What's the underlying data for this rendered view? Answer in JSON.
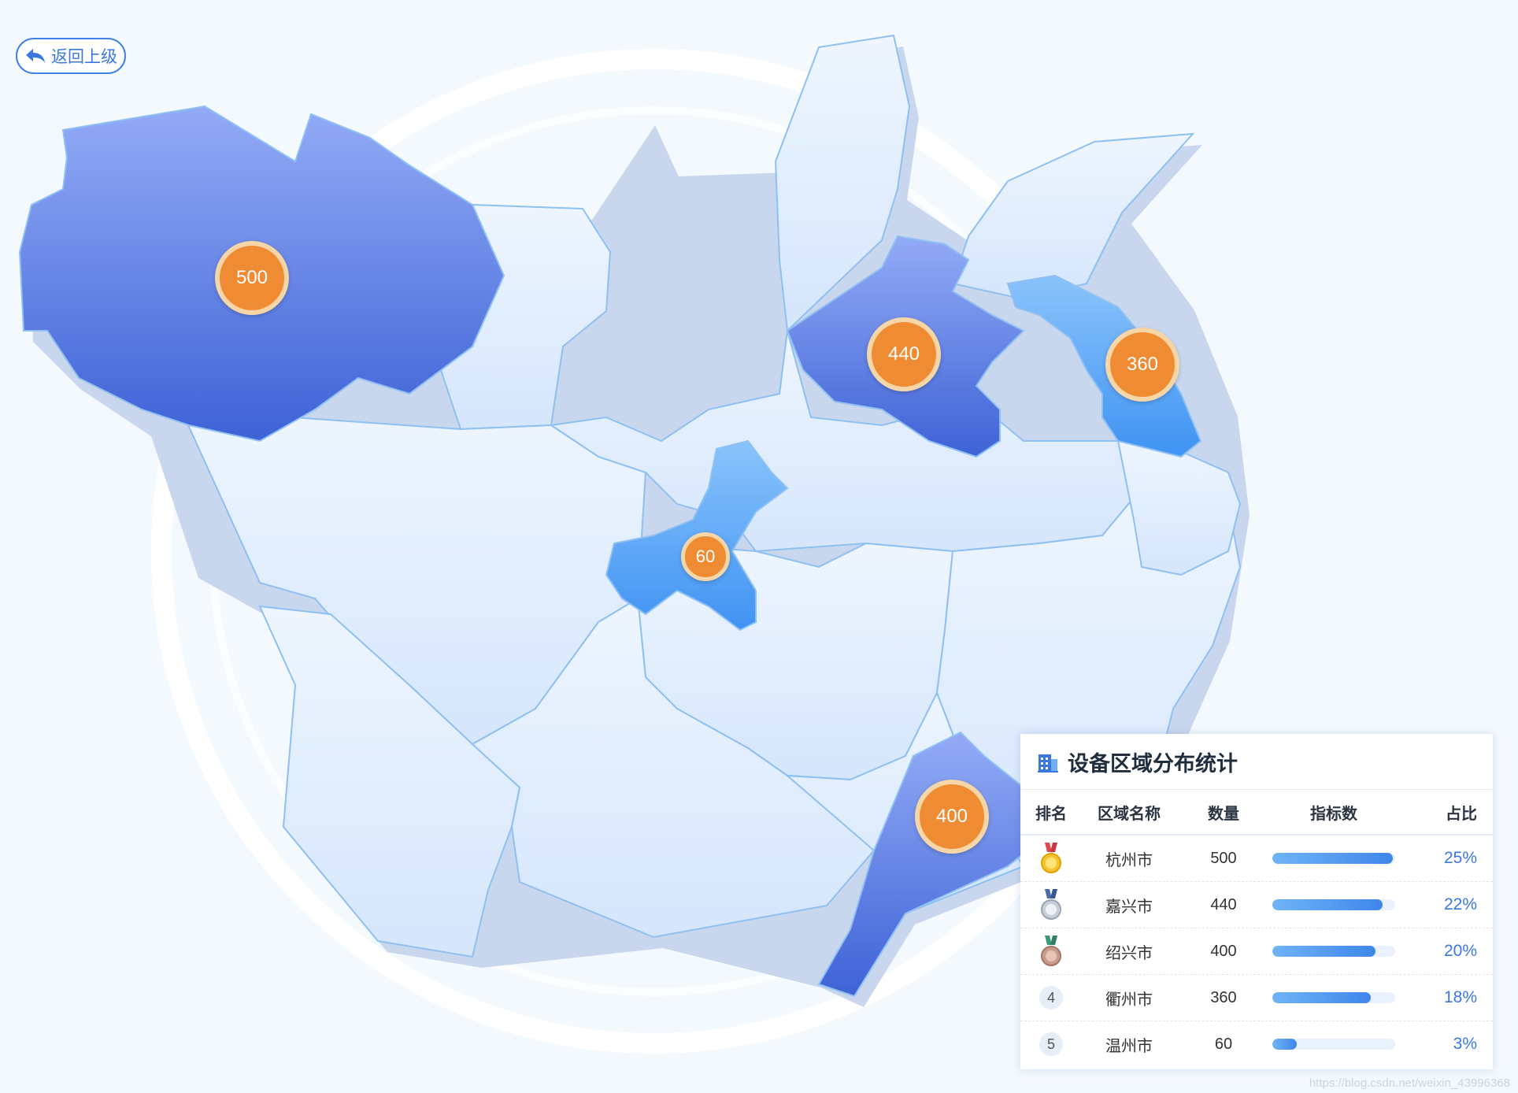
{
  "nav": {
    "back_label": "返回上级"
  },
  "regions": [
    {
      "name": "杭州市",
      "count": 500,
      "highlight": "dark"
    },
    {
      "name": "嘉兴市",
      "count": 440,
      "highlight": "dark"
    },
    {
      "name": "衢州市",
      "count": 360,
      "highlight": "medium"
    },
    {
      "name": "温州市",
      "count": 60,
      "highlight": "medium"
    },
    {
      "name": "绍兴市",
      "count": 400,
      "highlight": "dark"
    }
  ],
  "markers": [
    "500",
    "440",
    "360",
    "60",
    "400"
  ],
  "panel": {
    "title": "设备区域分布统计",
    "title_icon": "building-icon",
    "headers": {
      "rank": "排名",
      "name": "区域名称",
      "count": "数量",
      "index": "指标数",
      "ratio": "占比"
    },
    "rows": [
      {
        "rank": "1",
        "medal": "gold",
        "name": "杭州市",
        "count": "500",
        "fill": 0.98,
        "ratio": "25%"
      },
      {
        "rank": "2",
        "medal": "silver",
        "name": "嘉兴市",
        "count": "440",
        "fill": 0.9,
        "ratio": "22%"
      },
      {
        "rank": "3",
        "medal": "bronze",
        "name": "绍兴市",
        "count": "400",
        "fill": 0.84,
        "ratio": "20%"
      },
      {
        "rank": "4",
        "medal": "",
        "name": "衢州市",
        "count": "360",
        "fill": 0.8,
        "ratio": "18%"
      },
      {
        "rank": "5",
        "medal": "",
        "name": "温州市",
        "count": "60",
        "fill": 0.2,
        "ratio": "3%"
      }
    ]
  },
  "colors": {
    "region_base": "#e3eefc",
    "region_dark": "#4a74e0",
    "region_medium": "#4aa0f6",
    "marker": "#ef8b32",
    "accent": "#3a78e0"
  },
  "watermark": "https://blog.csdn.net/weixin_43996368"
}
